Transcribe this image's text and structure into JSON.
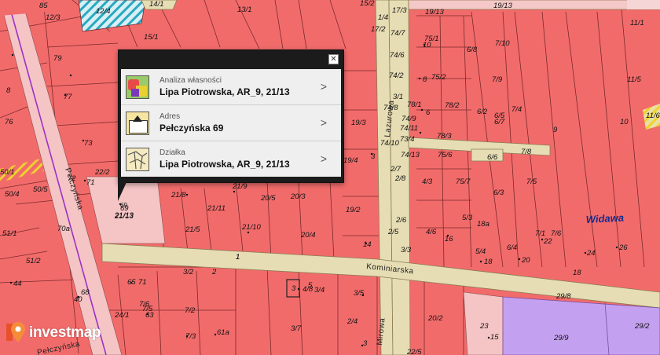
{
  "popup": {
    "close_glyph": "✕",
    "items": [
      {
        "sub": "Analiza własności",
        "main": "Lipa Piotrowska, AR_9, 21/13",
        "icon": "ownership-analysis-icon"
      },
      {
        "sub": "Adres",
        "main": "Pełczyńska 69",
        "icon": "address-envelope-icon"
      },
      {
        "sub": "Działka",
        "main": "Lipa Piotrowska, AR_9, 21/13",
        "icon": "parcel-map-icon"
      }
    ],
    "chevron": ">"
  },
  "logo": {
    "text": "investmap",
    "icon": "map-pin-icon"
  },
  "streets": {
    "pelczynska": "Pełczyńska",
    "kominiarska": "Kominiarska",
    "mirowa": "Mirowa",
    "lazurowa": "Lazurowa",
    "pelczynska_bottom": "Pełczyńska"
  },
  "region": "Widawa",
  "selected_parcel": {
    "number": "69",
    "label": "21/13"
  },
  "parcel_labels": [
    "85",
    "12/4",
    "14/1",
    "13/1",
    "15/2",
    "1/4",
    "17/3",
    "19/13",
    "19/13",
    "11/1",
    "12/3",
    "17/2",
    "74/7",
    "75/1",
    "6/8",
    "7/10",
    "10",
    "15/1",
    "79",
    "74/6",
    "11/5",
    "8",
    "75/2",
    "7/9",
    "77",
    "74/2",
    "3/1",
    "78/1",
    "6/2",
    "6/5",
    "7/4",
    "78/2",
    "6",
    "6/7",
    "9",
    "10",
    "8",
    "74/8",
    "74/9",
    "19/3",
    "78/3",
    "11/6",
    "76",
    "73",
    "74/10",
    "74/11",
    "73/4",
    "74/13",
    "75/6",
    "6/6",
    "7/8",
    "50/1",
    "3",
    "22/2",
    "71",
    "19/4",
    "2/7",
    "4/3",
    "75/7",
    "7/5",
    "50/4",
    "50/5",
    "72",
    "2/8",
    "6/3",
    "21/8",
    "21/9",
    "20/5",
    "20/3",
    "19/2",
    "69",
    "21/13",
    "21/11",
    "5/3",
    "18a",
    "Widawa",
    "1",
    "4/6",
    "7/1",
    "7/6",
    "51/1",
    "70a",
    "21/5",
    "21/10",
    "20/4",
    "2/6",
    "2/5",
    "5/4",
    "6/4",
    "22",
    "24",
    "26",
    "51/2",
    "14",
    "16",
    "18",
    "20",
    "1",
    "3/3",
    "2",
    "3/2",
    "18",
    "44",
    "65",
    "68",
    "71",
    "40",
    "7/6",
    "7/5",
    "63",
    "3",
    "4/8",
    "5",
    "3/4",
    "3/5",
    "20/2",
    "23",
    "29/8",
    "24/1",
    "7/2",
    "7/3",
    "61a",
    "3/7",
    "15",
    "29/9",
    "22/5",
    "3",
    "2/4",
    "29/2"
  ]
}
